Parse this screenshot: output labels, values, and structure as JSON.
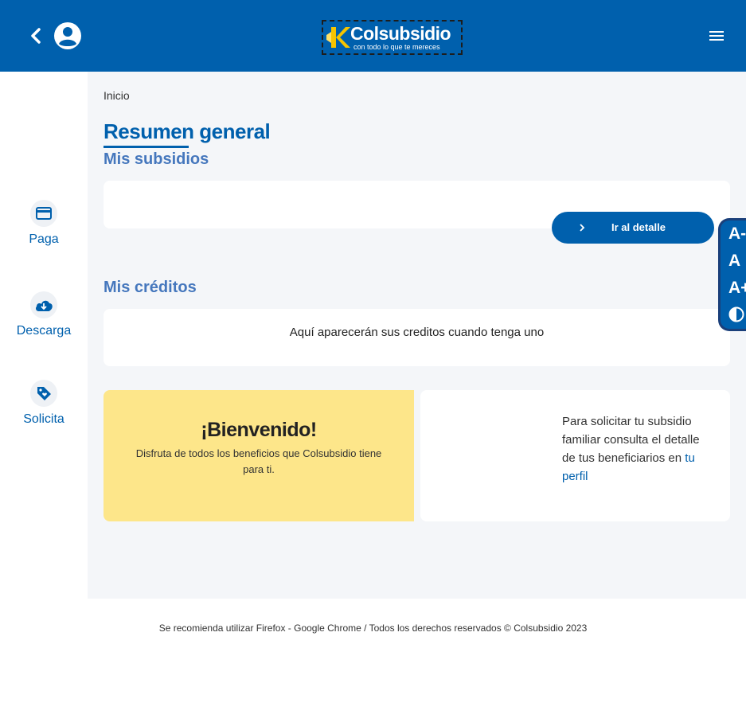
{
  "header": {
    "logo_name": "Colsubsidio",
    "logo_tagline": "con todo lo que te mereces"
  },
  "sidebar": {
    "items": [
      {
        "label": "Paga",
        "icon": "credit-card-icon"
      },
      {
        "label": "Descarga",
        "icon": "cloud-download-icon"
      },
      {
        "label": "Solicita",
        "icon": "tag-icon"
      }
    ]
  },
  "main": {
    "breadcrumb": "Inicio",
    "title": "Resumen general",
    "subsidios_title": "Mis subsidios",
    "detail_button": "Ir al detalle",
    "creditos_title": "Mis créditos",
    "creditos_empty": "Aquí aparecerán sus creditos cuando tenga uno",
    "welcome_title": "¡Bienvenido!",
    "welcome_text": "Disfruta de todos los beneficios que Colsubsidio tiene para ti.",
    "info_text": "Para solicitar tu subsidio familiar consulta el detalle de tus beneficiarios en",
    "info_link": "tu perfil"
  },
  "accessibility": {
    "decrease": "A-",
    "reset": "A",
    "increase": "A+"
  },
  "footer": "Se recomienda utilizar Firefox - Google Chrome / Todos los derechos reservados © Colsubsidio 2023",
  "colors": {
    "brand": "#0060ad",
    "accent": "#4577bd",
    "welcome_bg": "#fde68a"
  }
}
